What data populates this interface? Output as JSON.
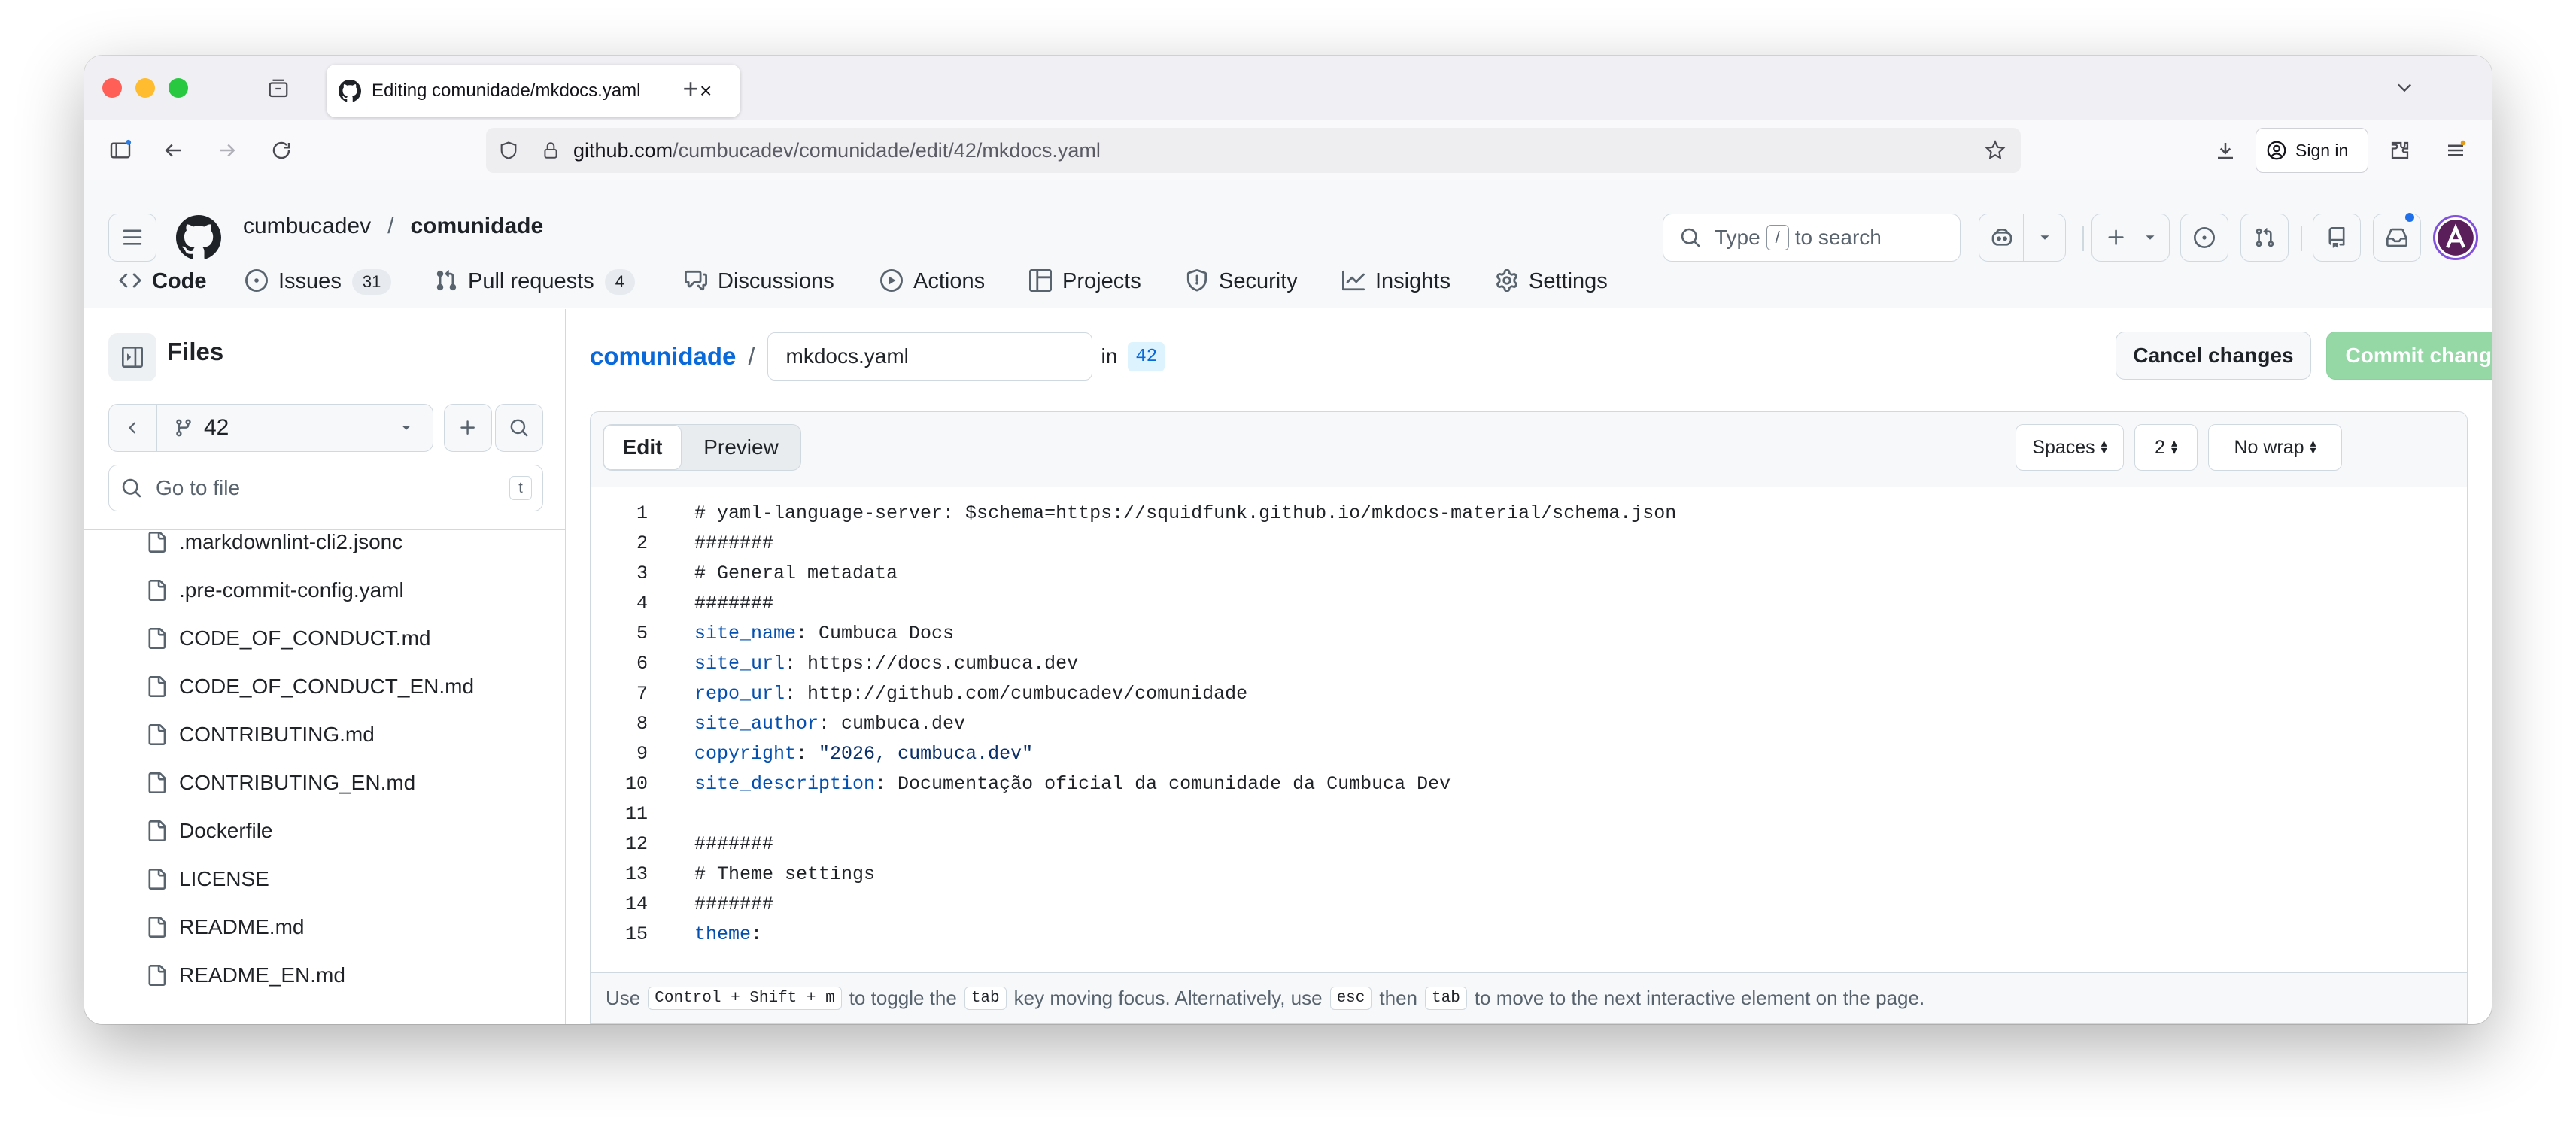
{
  "browser": {
    "tab_title": "Editing comunidade/mkdocs.yaml",
    "url_host": "github.com",
    "url_path": "/cumbucadev/comunidade/edit/42/mkdocs.yaml",
    "signin_label": "Sign in"
  },
  "header": {
    "owner": "cumbucadev",
    "separator": "/",
    "repo": "comunidade",
    "search_prefix": "Type",
    "search_key": "/",
    "search_suffix": "to search"
  },
  "reponav": [
    {
      "label": "Code",
      "icon": "code-icon"
    },
    {
      "label": "Issues",
      "count": "31",
      "icon": "issue-icon"
    },
    {
      "label": "Pull requests",
      "count": "4",
      "icon": "pull-request-icon"
    },
    {
      "label": "Discussions",
      "icon": "discussion-icon"
    },
    {
      "label": "Actions",
      "icon": "play-icon"
    },
    {
      "label": "Projects",
      "icon": "table-icon"
    },
    {
      "label": "Security",
      "icon": "shield-icon"
    },
    {
      "label": "Insights",
      "icon": "graph-icon"
    },
    {
      "label": "Settings",
      "icon": "gear-icon"
    }
  ],
  "sidebar": {
    "title": "Files",
    "branch": "42",
    "goto_placeholder": "Go to file",
    "goto_key": "t",
    "files": [
      ".markdownlint-cli2.jsonc",
      ".pre-commit-config.yaml",
      "CODE_OF_CONDUCT.md",
      "CODE_OF_CONDUCT_EN.md",
      "CONTRIBUTING.md",
      "CONTRIBUTING_EN.md",
      "Dockerfile",
      "LICENSE",
      "README.md",
      "README_EN.md"
    ]
  },
  "editor": {
    "repo_link": "comunidade",
    "slash": "/",
    "filename": "mkdocs.yaml",
    "in_label": "in",
    "branch": "42",
    "cancel_label": "Cancel changes",
    "commit_label": "Commit changes...",
    "tab_edit": "Edit",
    "tab_preview": "Preview",
    "indent_mode": "Spaces",
    "indent_size": "2",
    "wrap_mode": "No wrap",
    "lines": [
      {
        "n": "1",
        "text": "# yaml-language-server: $schema=https://squidfunk.github.io/mkdocs-material/schema.json"
      },
      {
        "n": "2",
        "text": "#######"
      },
      {
        "n": "3",
        "text": "# General metadata"
      },
      {
        "n": "4",
        "text": "#######"
      },
      {
        "n": "5",
        "key": "site_name",
        "rest": ": Cumbuca Docs"
      },
      {
        "n": "6",
        "key": "site_url",
        "rest": ": https://docs.cumbuca.dev"
      },
      {
        "n": "7",
        "key": "repo_url",
        "rest": ": http://github.com/cumbucadev/comunidade"
      },
      {
        "n": "8",
        "key": "site_author",
        "rest": ": cumbuca.dev"
      },
      {
        "n": "9",
        "key": "copyright",
        "rest": ": ",
        "str": "\"2026, cumbuca.dev\""
      },
      {
        "n": "10",
        "key": "site_description",
        "rest": ": Documentação oficial da comunidade da Cumbuca Dev"
      },
      {
        "n": "11",
        "text": ""
      },
      {
        "n": "12",
        "text": "#######"
      },
      {
        "n": "13",
        "text": "# Theme settings"
      },
      {
        "n": "14",
        "text": "#######"
      },
      {
        "n": "15",
        "key": "theme",
        "rest": ":"
      }
    ],
    "status": {
      "t1": "Use",
      "k1": "Control + Shift + m",
      "t2": "to toggle the",
      "k2": "tab",
      "t3": "key moving focus. Alternatively, use",
      "k3": "esc",
      "t4": "then",
      "k4": "tab",
      "t5": "to move to the next interactive element on the page."
    }
  },
  "colors": {
    "link_blue": "#0969da",
    "commit_disabled": "#95d8a6",
    "active_tab_underline": "#fd8c73",
    "yaml_key": "#0550ae"
  }
}
